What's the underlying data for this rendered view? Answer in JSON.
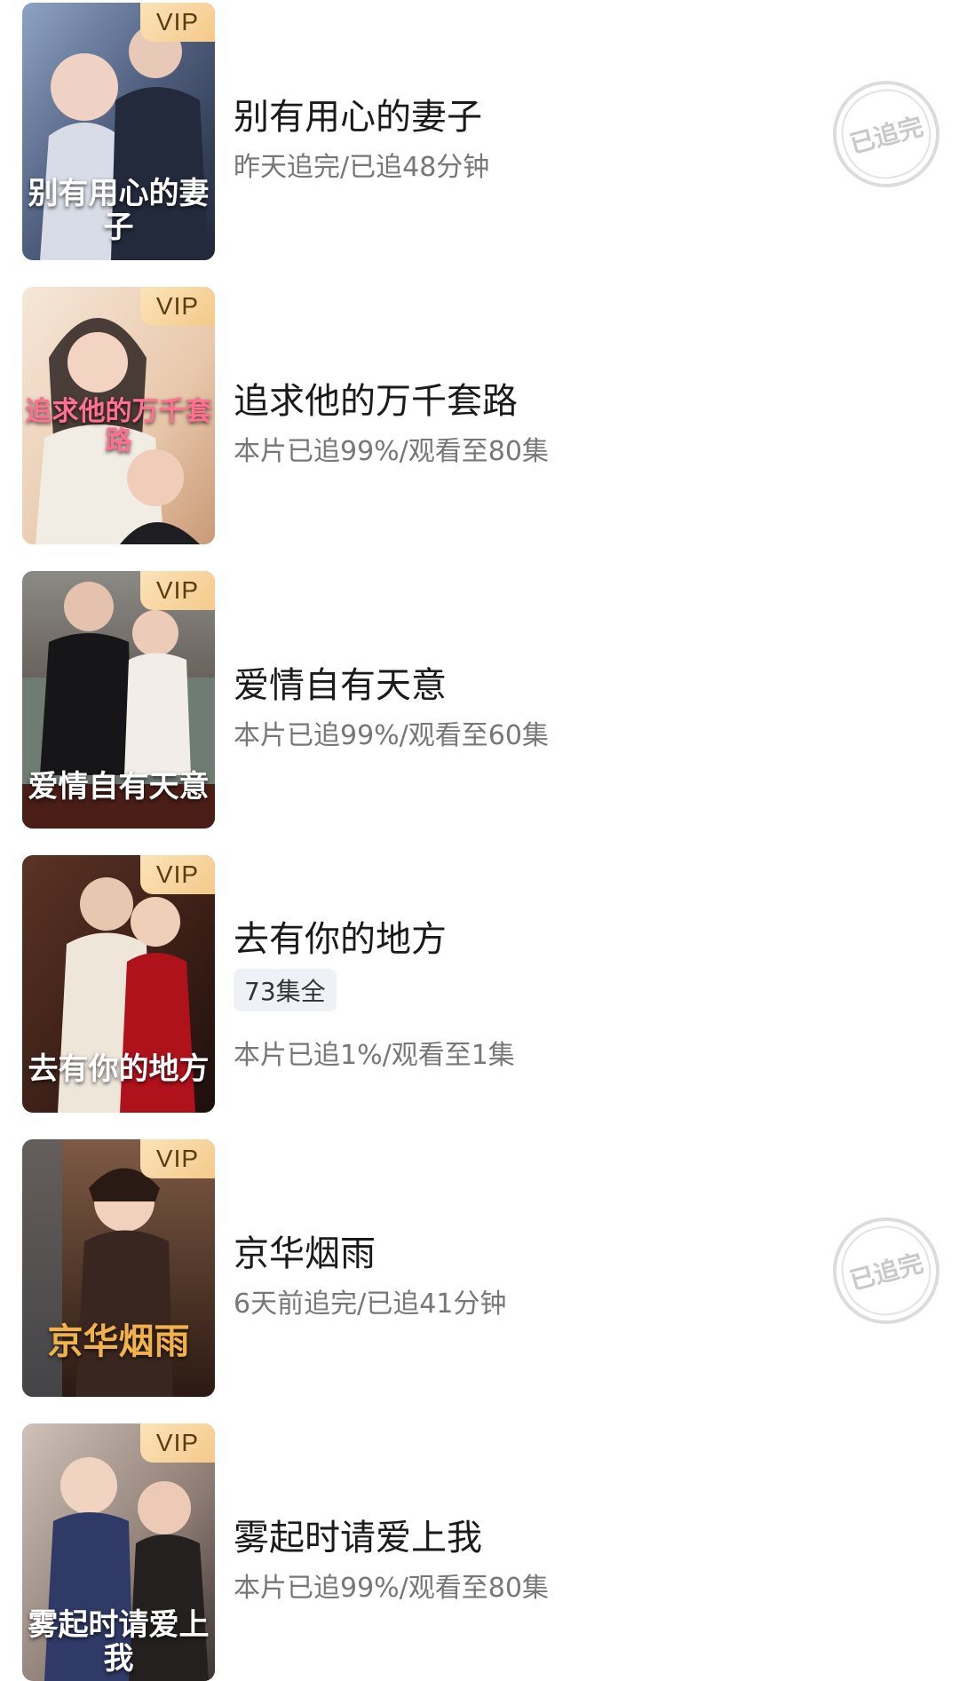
{
  "items": [
    {
      "title": "别有用心的妻子",
      "progress": "昨天追完/已追48分钟",
      "badge": "VIP",
      "poster_text": "别有用心的妻子",
      "stamp": "已追完"
    },
    {
      "title": "追求他的万千套路",
      "progress": "本片已追99%/观看至80集",
      "badge": "VIP",
      "poster_text": "追求他的万千套路"
    },
    {
      "title": "爱情自有天意",
      "progress": "本片已追99%/观看至60集",
      "badge": "VIP",
      "poster_text": "爱情自有天意"
    },
    {
      "title": "去有你的地方",
      "episodes_tag": "73集全",
      "progress": "本片已追1%/观看至1集",
      "badge": "VIP",
      "poster_text": "去有你的地方"
    },
    {
      "title": "京华烟雨",
      "progress": "6天前追完/已追41分钟",
      "badge": "VIP",
      "poster_text": "京华烟雨",
      "stamp": "已追完"
    },
    {
      "title": "雾起时请爱上我",
      "progress": "本片已追99%/观看至80集",
      "badge": "VIP",
      "poster_text": "雾起时请爱上我"
    }
  ]
}
